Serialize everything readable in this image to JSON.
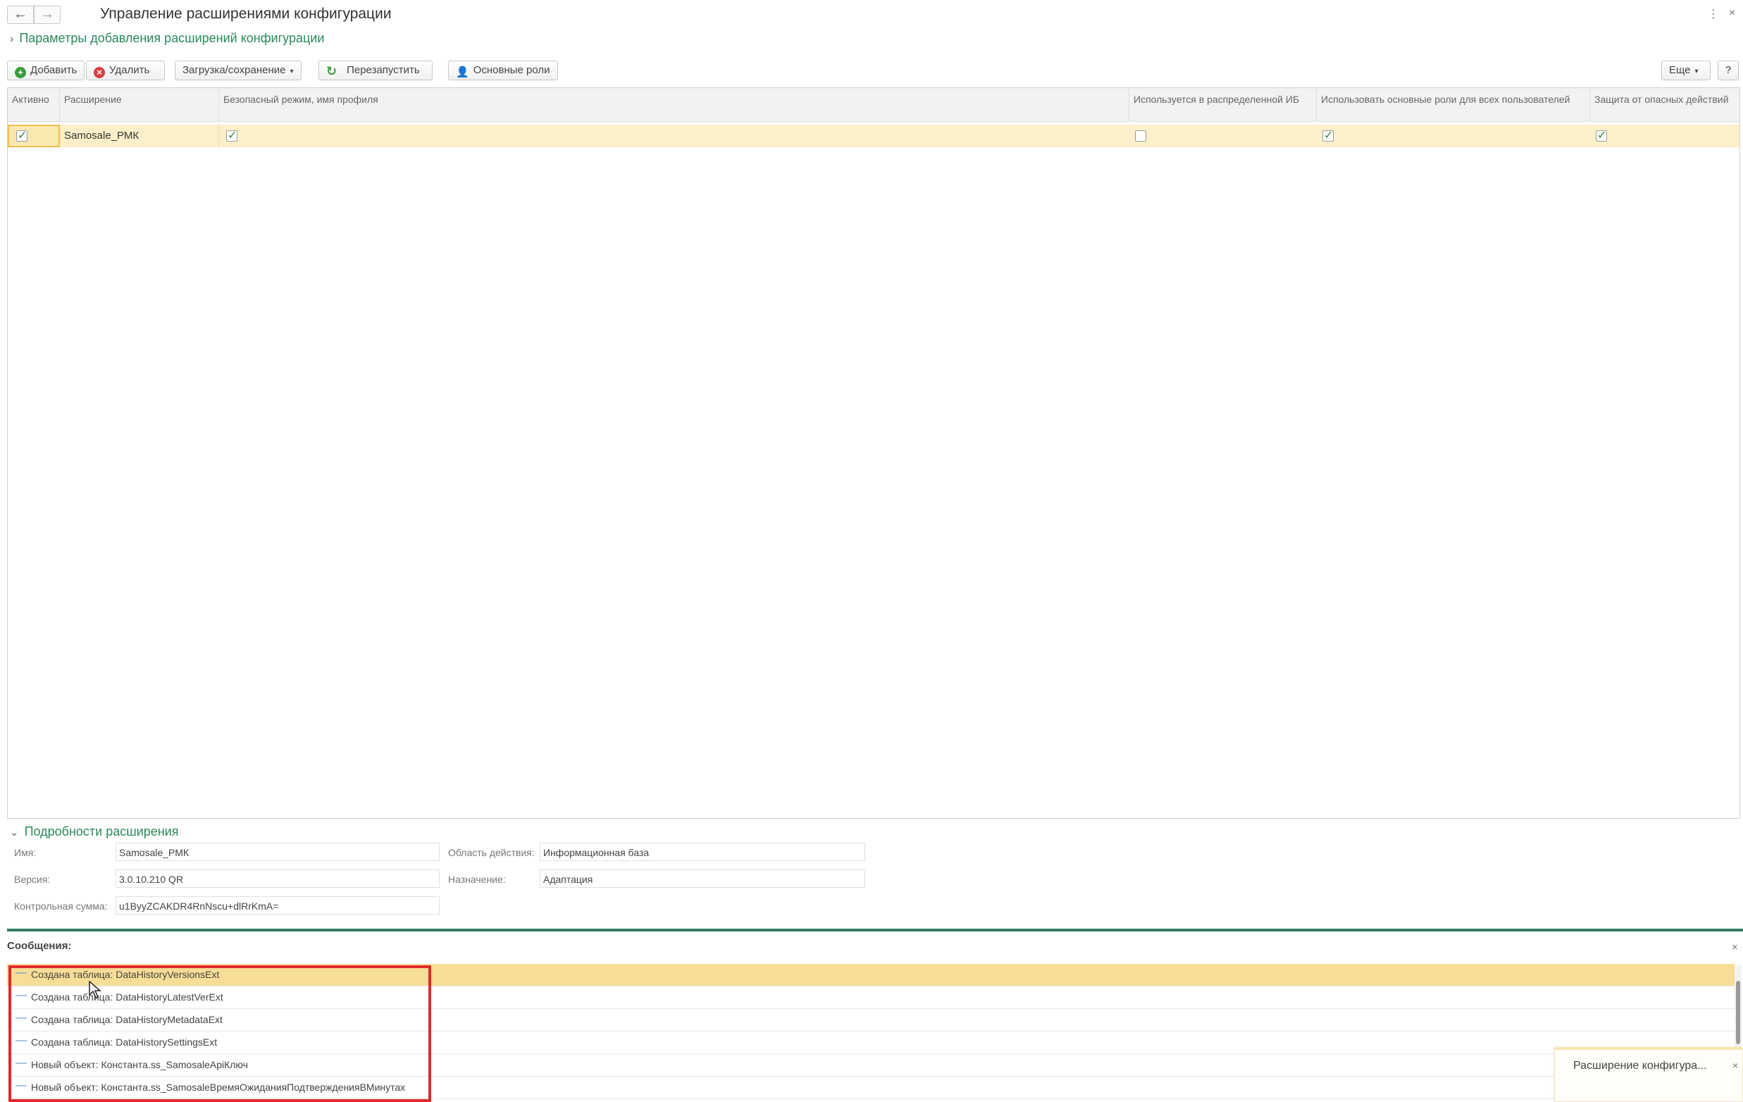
{
  "window": {
    "title": "Управление расширениями конфигурации",
    "back_glyph": "←",
    "forward_glyph": "→",
    "menu_glyph": "⋮",
    "close_glyph": "×"
  },
  "params_link": "Параметры добавления расширений конфигурации",
  "toolbar": {
    "add": "Добавить",
    "delete": "Удалить",
    "load_save": "Загрузка/сохранение",
    "restart": "Перезапустить",
    "roles": "Основные роли",
    "more": "Еще",
    "help": "?"
  },
  "table": {
    "columns": [
      "Активно",
      "Расширение",
      "Безопасный режим, имя профиля",
      "Используется в распределенной ИБ",
      "Использовать основные роли для всех пользователей",
      "Защита от опасных действий"
    ],
    "rows": [
      {
        "active": true,
        "extension": "Samosale_РМК",
        "safe_mode": true,
        "distributed": false,
        "main_roles": true,
        "protection": true
      }
    ]
  },
  "details": {
    "title": "Подробности расширения",
    "name_label": "Имя:",
    "name_value": "Samosale_РМК",
    "version_label": "Версия:",
    "version_value": "3.0.10.210 QR",
    "checksum_label": "Контрольная сумма:",
    "checksum_value": "u1ByyZCAKDR4RnNscu+dlRrKmA=",
    "scope_label": "Область действия:",
    "scope_value": "Информационная база",
    "purpose_label": "Назначение:",
    "purpose_value": "Адаптация"
  },
  "messages": {
    "title": "Сообщения:",
    "items": [
      "Создана таблица: DataHistoryVersionsExt",
      "Создана таблица: DataHistoryLatestVerExt",
      "Создана таблица: DataHistoryMetadataExt",
      "Создана таблица: DataHistorySettingsExt",
      "Новый объект: Константа.ss_SamosaleApiКлюч",
      "Новый объект: Константа.ss_SamosaleВремяОжиданияПодтвержденияВМинутах"
    ]
  },
  "toast": {
    "text": "Расширение конфигура..."
  },
  "colors": {
    "accent_green": "#2a8a5c",
    "selected_row": "#fbf0c9",
    "highlight_border": "#e02a2a"
  }
}
